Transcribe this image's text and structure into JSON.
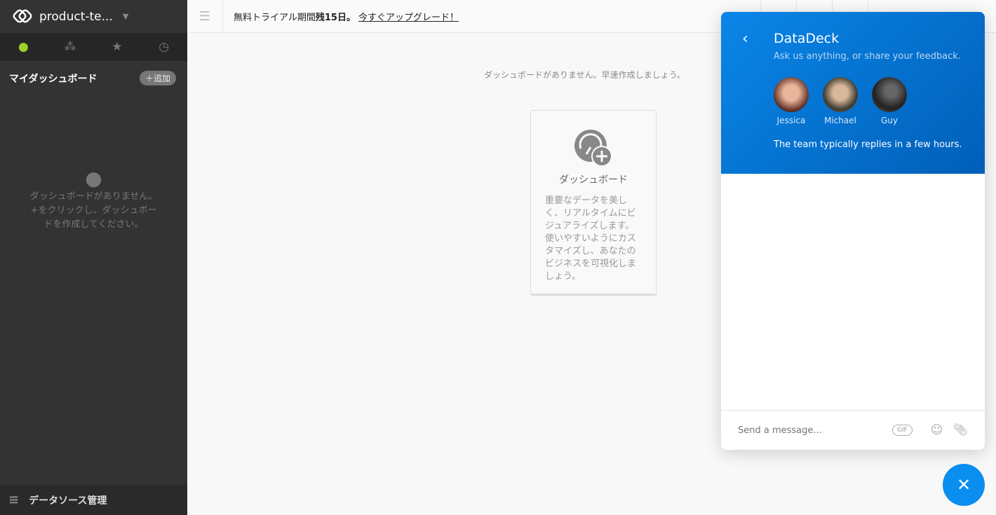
{
  "sidebar": {
    "workspace": "product-te...",
    "tabs": [
      {
        "icon": "person-icon",
        "active": true
      },
      {
        "icon": "team-icon"
      },
      {
        "icon": "star-icon"
      },
      {
        "icon": "clock-icon"
      }
    ],
    "section_title": "マイダッシュボード",
    "add_label": "＋追加",
    "empty_text": [
      "ダッシュボードがありません。",
      "+をクリックし、ダッシュボー",
      "ドを作成してください。"
    ],
    "datasource_label": "データソース管理"
  },
  "topbar": {
    "trial_prefix": "無料トライアル期間",
    "trial_days": "残15日。",
    "upgrade_link": "今すぐアップグレード！"
  },
  "main": {
    "empty_message": "ダッシュボードがありません。早速作成しましょう。",
    "card": {
      "title": "ダッシュボード",
      "description": "重要なデータを美しく、リアルタイムにビジュアライズします。使いやすいようにカスタマイズし、あなたのビジネスを可視化しましょう。"
    }
  },
  "chat": {
    "title": "DataDeck",
    "subtitle": "Ask us anything, or share your feedback.",
    "team": [
      {
        "name": "Jessica",
        "color": "#c0604a"
      },
      {
        "name": "Michael",
        "color": "#4a4a40"
      },
      {
        "name": "Guy",
        "color": "#333"
      }
    ],
    "reply_time": "The team typically replies in a few hours.",
    "placeholder": "Send a message...",
    "gif_label": "GIF",
    "header_color": "#0a86e8"
  }
}
